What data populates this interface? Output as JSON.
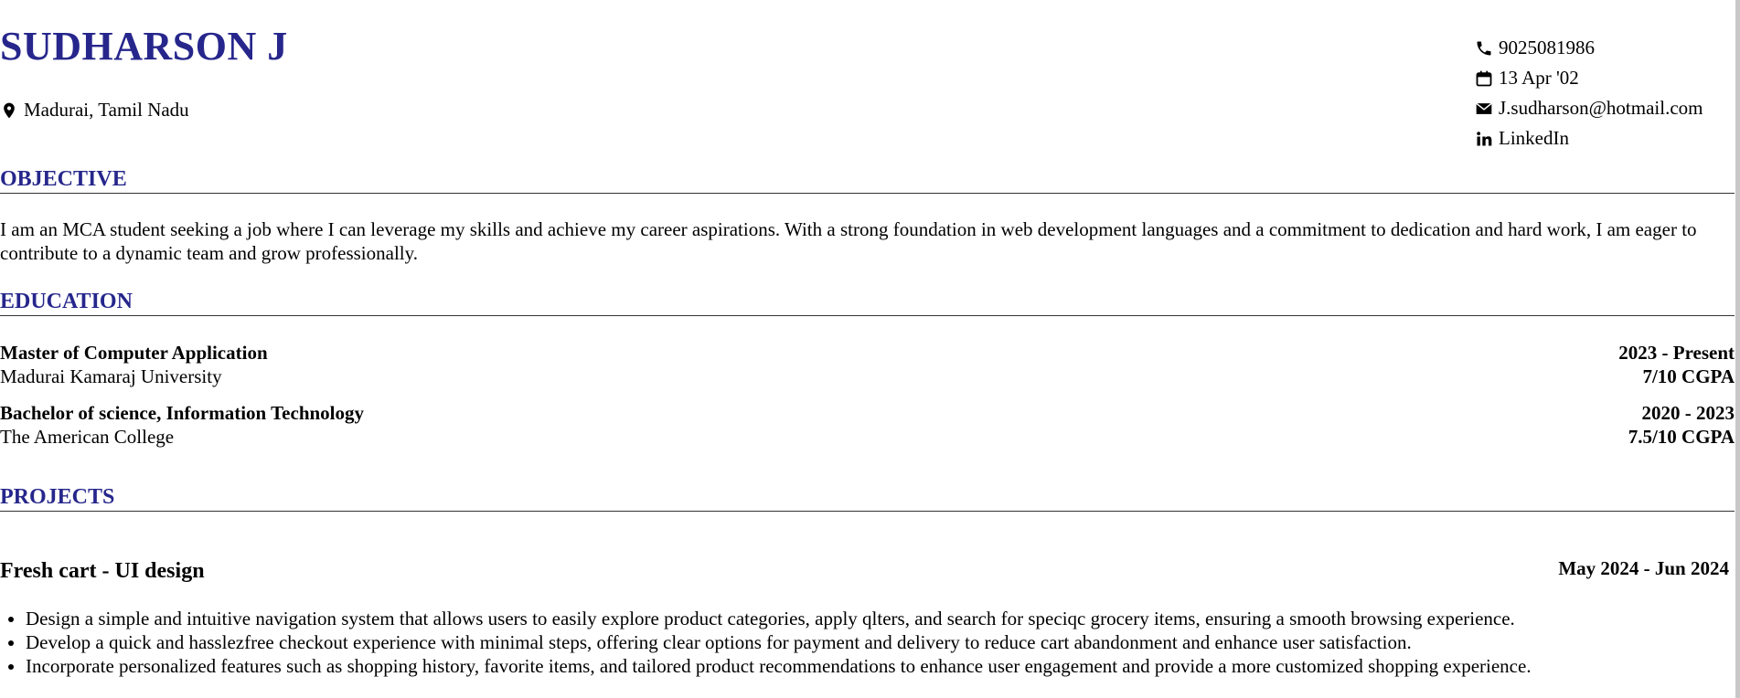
{
  "header": {
    "name": "SUDHARSON J",
    "location": "Madurai, Tamil Nadu",
    "contact": {
      "phone": "9025081986",
      "dob": "13 Apr '02",
      "email": "J.sudharson@hotmail.com",
      "linkedin": "LinkedIn"
    }
  },
  "objective": {
    "title": "OBJECTIVE",
    "text": "I am an MCA student seeking a job where I can leverage my skills and achieve my career aspirations. With a strong foundation in web development languages and a commitment to dedication and hard work, I am eager to contribute to a dynamic team and grow professionally."
  },
  "education": {
    "title": "EDUCATION",
    "items": [
      {
        "degree": "Master of Computer Application",
        "institution": "Madurai Kamaraj University",
        "years": "2023 - Present",
        "score": "7/10 CGPA"
      },
      {
        "degree": "Bachelor of science, Information Technology",
        "institution": "The American College",
        "years": "2020 - 2023",
        "score": "7.5/10 CGPA"
      }
    ]
  },
  "projects": {
    "title": "PROJECTS",
    "items": [
      {
        "name": "Fresh cart - UI design",
        "dates": "May 2024 - Jun 2024",
        "bullets": [
          "Design a simple and intuitive navigation system that allows users to easily explore product categories, apply qlters, and search for speciqc grocery items, ensuring a smooth browsing experience.",
          "Develop a quick and hasslezfree checkout experience with minimal steps, offering clear options for payment and delivery to reduce cart abandonment and enhance user satisfaction.",
          "Incorporate personalized features such as shopping history, favorite items, and tailored product recommendations to enhance user engagement and provide a more customized shopping experience."
        ]
      }
    ]
  },
  "colors": {
    "accent": "#26268c",
    "text": "#000000",
    "rule": "#333333"
  },
  "icons": {
    "location": "map-pin-icon",
    "phone": "phone-icon",
    "dob": "calendar-icon",
    "email": "envelope-icon",
    "linkedin": "linkedin-icon"
  }
}
